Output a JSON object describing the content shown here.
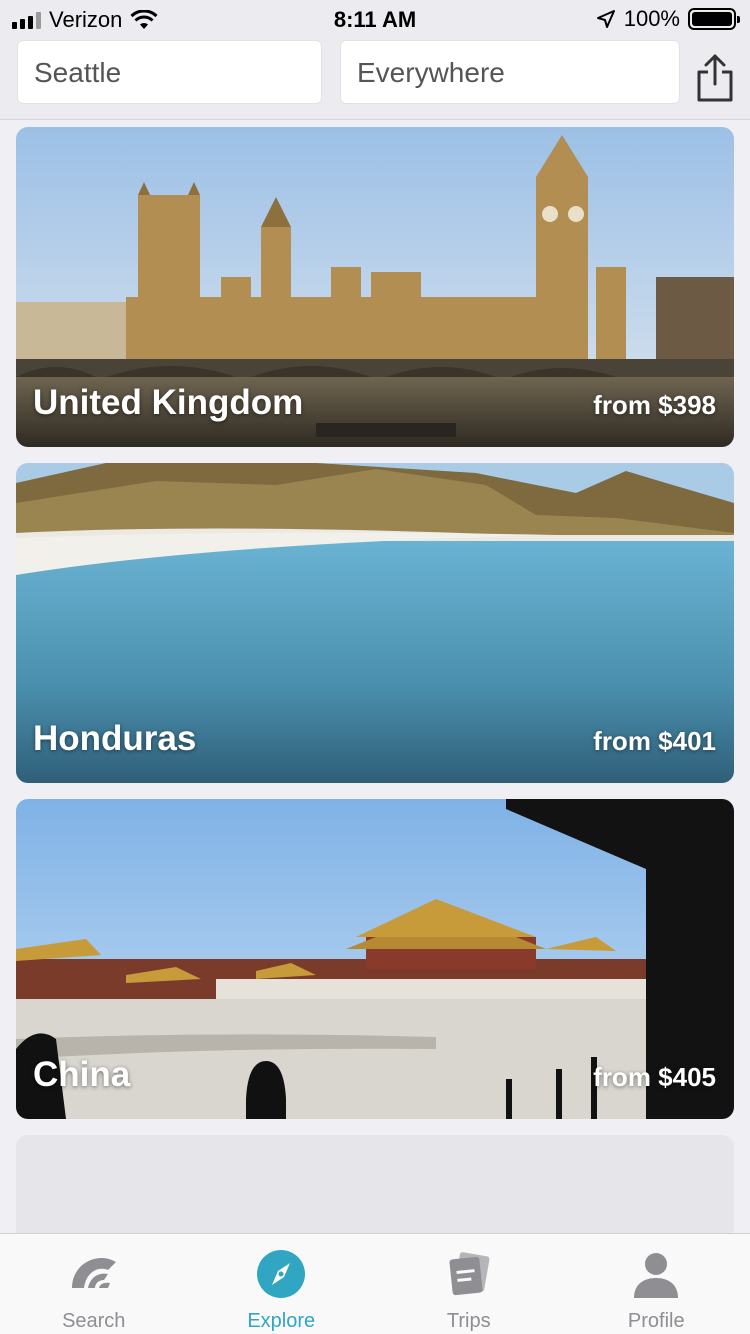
{
  "status_bar": {
    "carrier": "Verizon",
    "time": "8:11 AM",
    "battery": "100%"
  },
  "header": {
    "origin": "Seattle",
    "destination": "Everywhere",
    "share_icon": "share-icon"
  },
  "destinations": [
    {
      "name": "United Kingdom",
      "price": "from $398"
    },
    {
      "name": "Honduras",
      "price": "from $401"
    },
    {
      "name": "China",
      "price": "from $405"
    }
  ],
  "tabs": [
    {
      "label": "Search",
      "icon": "skyscanner-logo-icon",
      "active": false
    },
    {
      "label": "Explore",
      "icon": "compass-icon",
      "active": true
    },
    {
      "label": "Trips",
      "icon": "trips-icon",
      "active": false
    },
    {
      "label": "Profile",
      "icon": "profile-icon",
      "active": false
    }
  ],
  "colors": {
    "accent": "#31a6c2",
    "inactive": "#8e8e93"
  }
}
